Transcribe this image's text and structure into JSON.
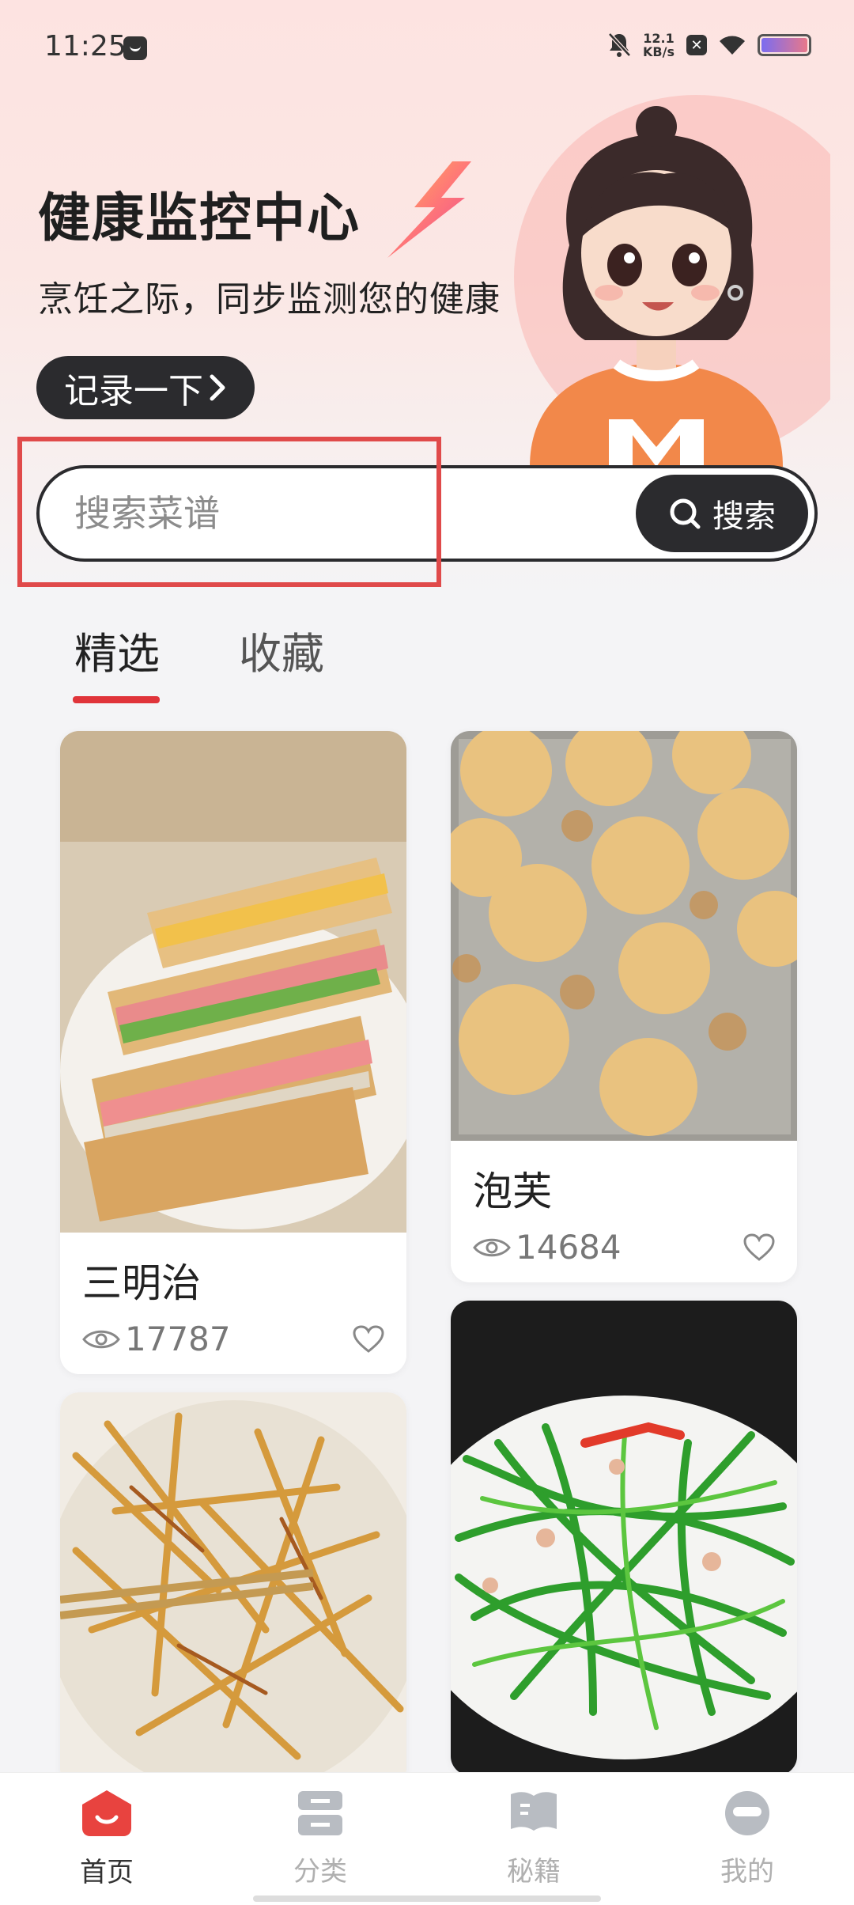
{
  "status_bar": {
    "time": "11:25",
    "speed_value": "12.1",
    "speed_unit": "KB/s"
  },
  "header": {
    "title": "健康监控中心",
    "subtitle": "烹饪之际，同步监测您的健康",
    "record_button_label": "记录一下"
  },
  "search": {
    "placeholder": "搜索菜谱",
    "button_label": "搜索"
  },
  "tabs": [
    {
      "label": "精选",
      "active": true
    },
    {
      "label": "收藏",
      "active": false
    }
  ],
  "recipes": [
    {
      "name": "三明治",
      "views": "17787"
    },
    {
      "name": "泡芙",
      "views": "14684"
    },
    {
      "name": "",
      "views": ""
    },
    {
      "name": "",
      "views": ""
    }
  ],
  "bottom_nav": [
    {
      "label": "首页",
      "icon": "home-icon",
      "active": true
    },
    {
      "label": "分类",
      "icon": "category-icon",
      "active": false
    },
    {
      "label": "秘籍",
      "icon": "book-icon",
      "active": false
    },
    {
      "label": "我的",
      "icon": "profile-icon",
      "active": false
    }
  ],
  "colors": {
    "accent": "#e0343a",
    "dark": "#2b2b2e",
    "highlight": "#e04a4a"
  }
}
